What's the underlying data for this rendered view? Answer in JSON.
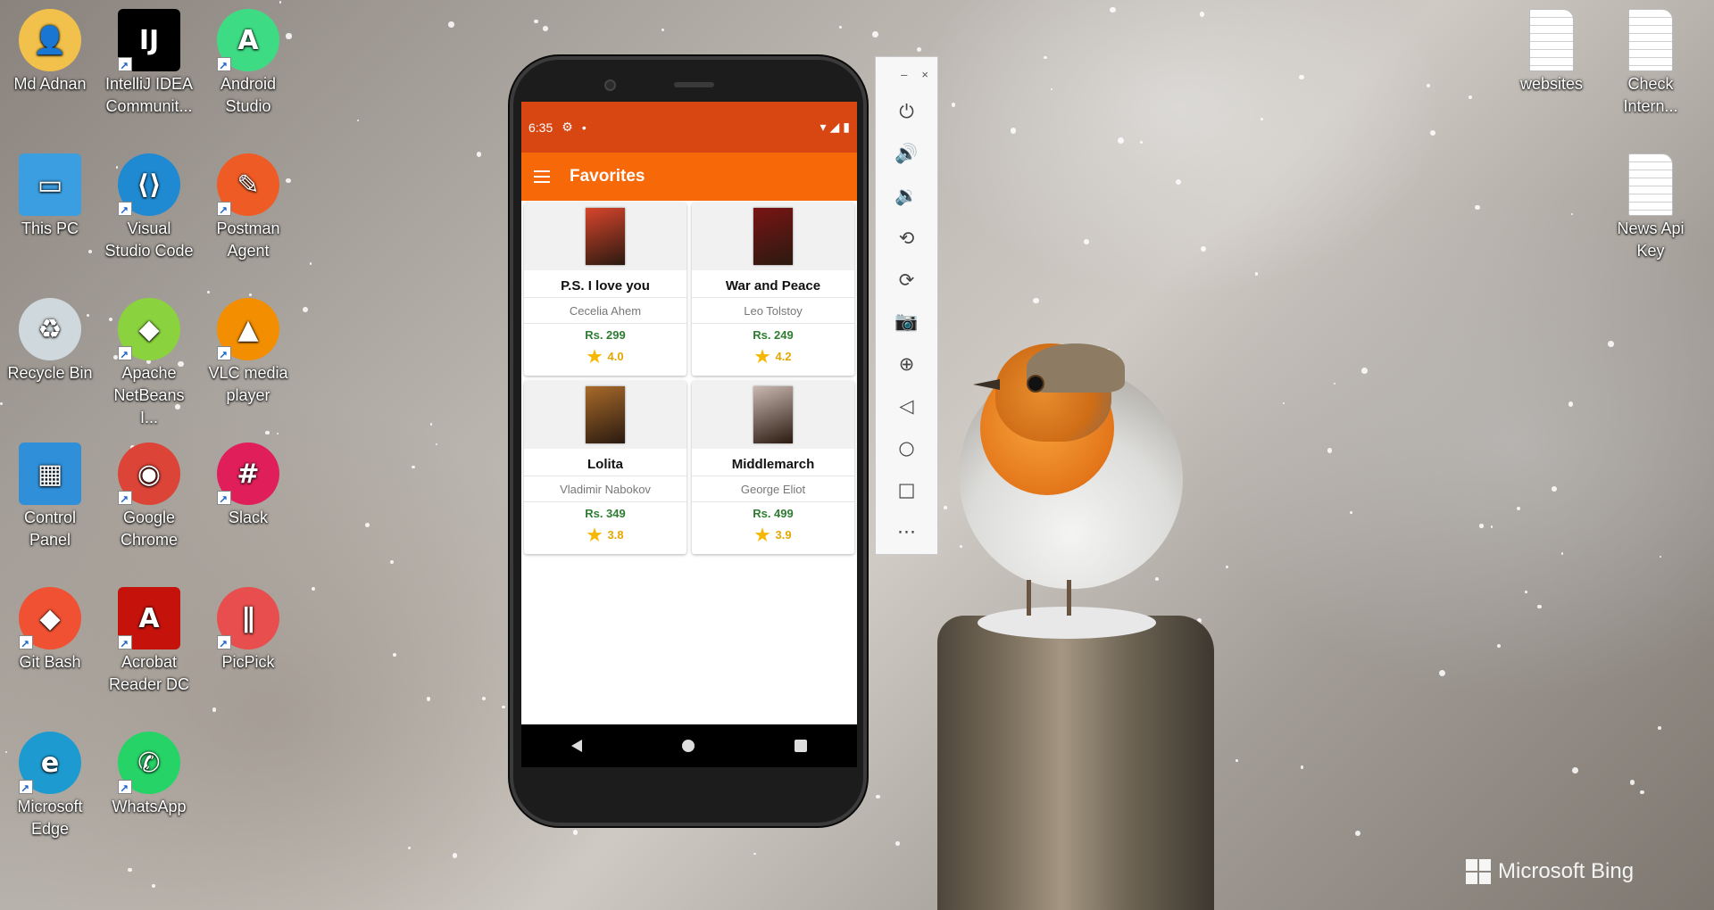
{
  "desktop": {
    "left_icons": [
      {
        "id": "md-adnan",
        "label": "Md Adnan",
        "icon": "user-folder-icon",
        "color": "#f1c14b"
      },
      {
        "id": "intellij",
        "label": "IntelliJ IDEA Communit...",
        "icon": "intellij-icon",
        "color": "#000000"
      },
      {
        "id": "android-studio",
        "label": "Android Studio",
        "icon": "android-studio-icon",
        "color": "#3ddc84"
      },
      {
        "id": "this-pc",
        "label": "This PC",
        "icon": "computer-icon",
        "color": "#3a9ee0"
      },
      {
        "id": "vscode",
        "label": "Visual Studio Code",
        "icon": "vscode-icon",
        "color": "#1f8ad2"
      },
      {
        "id": "postman",
        "label": "Postman Agent",
        "icon": "postman-icon",
        "color": "#ef5b25"
      },
      {
        "id": "recycle-bin",
        "label": "Recycle Bin",
        "icon": "recycle-bin-icon",
        "color": "#cfd8dc"
      },
      {
        "id": "netbeans",
        "label": "Apache NetBeans I...",
        "icon": "netbeans-icon",
        "color": "#8ad23e"
      },
      {
        "id": "vlc",
        "label": "VLC media player",
        "icon": "vlc-icon",
        "color": "#f28e00"
      },
      {
        "id": "control-panel",
        "label": "Control Panel",
        "icon": "control-panel-icon",
        "color": "#2f8fd8"
      },
      {
        "id": "chrome",
        "label": "Google Chrome",
        "icon": "chrome-icon",
        "color": "#db4437"
      },
      {
        "id": "slack",
        "label": "Slack",
        "icon": "slack-icon",
        "color": "#e01e5a"
      },
      {
        "id": "git-bash",
        "label": "Git Bash",
        "icon": "git-bash-icon",
        "color": "#f05133"
      },
      {
        "id": "acrobat",
        "label": "Acrobat Reader DC",
        "icon": "acrobat-icon",
        "color": "#c5120b"
      },
      {
        "id": "picpick",
        "label": "PicPick",
        "icon": "picpick-icon",
        "color": "#e94e4e"
      },
      {
        "id": "edge",
        "label": "Microsoft Edge",
        "icon": "edge-icon",
        "color": "#1d9bd1"
      },
      {
        "id": "whatsapp",
        "label": "WhatsApp",
        "icon": "whatsapp-icon",
        "color": "#25d366"
      }
    ],
    "right_icons": [
      {
        "id": "websites",
        "label": "websites",
        "icon": "text-file-icon"
      },
      {
        "id": "check-intern",
        "label": "Check Intern...",
        "icon": "text-file-icon"
      },
      {
        "id": "news-api-key",
        "label": "News Api Key",
        "icon": "text-file-icon"
      }
    ],
    "watermark": "Microsoft Bing"
  },
  "phone": {
    "status_time": "6:35",
    "status_icons": [
      "gear-icon",
      "dot-icon",
      "wifi-icon",
      "signal-icon",
      "battery-icon"
    ],
    "app_title": "Favorites",
    "accent_color": "#f76808",
    "status_bar_color": "#d84612",
    "books": [
      {
        "title": "P.S. I love you",
        "author": "Cecelia Ahem",
        "price": "Rs. 299",
        "rating": "4.0",
        "cover_color": "#d8452c"
      },
      {
        "title": "War and Peace",
        "author": "Leo Tolstoy",
        "price": "Rs. 249",
        "rating": "4.2",
        "cover_color": "#7a1414"
      },
      {
        "title": "Lolita",
        "author": "Vladimir Nabokov",
        "price": "Rs. 349",
        "rating": "3.8",
        "cover_color": "#a86a2a"
      },
      {
        "title": "Middlemarch",
        "author": "George Eliot",
        "price": "Rs. 499",
        "rating": "3.9",
        "cover_color": "#c9b8b0"
      }
    ]
  },
  "emulator_panel": {
    "window_controls": {
      "minimize": "–",
      "close": "×"
    },
    "buttons": [
      {
        "id": "power",
        "icon": "power-icon",
        "glyph": "⏻"
      },
      {
        "id": "volume-up",
        "icon": "volume-up-icon",
        "glyph": "🔊"
      },
      {
        "id": "volume-down",
        "icon": "volume-down-icon",
        "glyph": "🔉"
      },
      {
        "id": "rotate-left",
        "icon": "rotate-left-icon",
        "glyph": "⟲"
      },
      {
        "id": "rotate-right",
        "icon": "rotate-right-icon",
        "glyph": "⟳"
      },
      {
        "id": "screenshot",
        "icon": "camera-icon",
        "glyph": "📷"
      },
      {
        "id": "zoom",
        "icon": "zoom-icon",
        "glyph": "⊕"
      },
      {
        "id": "back",
        "icon": "back-icon",
        "glyph": "◁"
      },
      {
        "id": "home",
        "icon": "home-icon",
        "glyph": "○"
      },
      {
        "id": "overview",
        "icon": "overview-icon",
        "glyph": "□"
      },
      {
        "id": "more",
        "icon": "more-icon",
        "glyph": "⋯"
      }
    ]
  }
}
